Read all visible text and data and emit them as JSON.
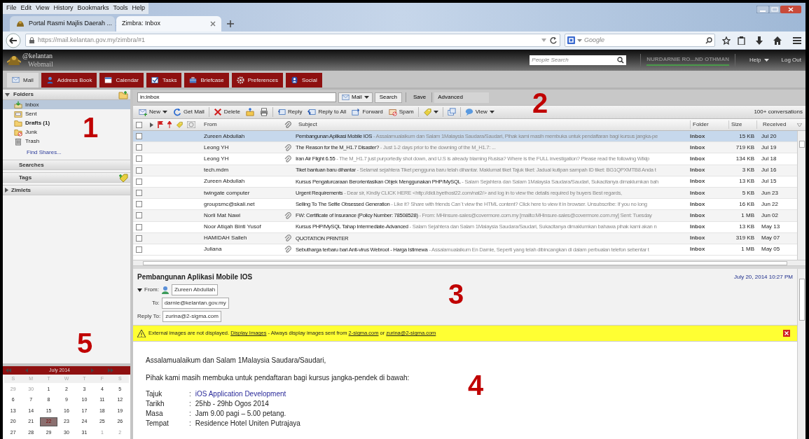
{
  "browser": {
    "menu": [
      "File",
      "Edit",
      "View",
      "History",
      "Bookmarks",
      "Tools",
      "Help"
    ],
    "tabs": [
      {
        "label": "Portal Rasmi Majlis Daerah ...",
        "selected": false
      },
      {
        "label": "Zimbra: Inbox",
        "selected": true
      }
    ],
    "url": "https://mail.kelantan.gov.my/zimbra/#1",
    "search_placeholder": "Google"
  },
  "header": {
    "logo_line1": "@kelantan",
    "logo_line2": "Webmail",
    "people_search_placeholder": "People Search",
    "user": "NURDARNIE RO...ND OTHMAN",
    "help": "Help",
    "logout": "Log Out"
  },
  "app_tabs": [
    {
      "label": "Mail",
      "kind": "mail",
      "selected": true
    },
    {
      "label": "Address Book",
      "kind": "contacts",
      "selected": false
    },
    {
      "label": "Calendar",
      "kind": "calendar",
      "selected": false
    },
    {
      "label": "Tasks",
      "kind": "tasks",
      "selected": false
    },
    {
      "label": "Briefcase",
      "kind": "briefcase",
      "selected": false
    },
    {
      "label": "Preferences",
      "kind": "preferences",
      "selected": false
    },
    {
      "label": "Social",
      "kind": "social",
      "selected": false
    }
  ],
  "sidebar": {
    "folders_title": "Folders",
    "folders": [
      {
        "label": "Inbox",
        "kind": "inbox",
        "selected": true,
        "unread": false
      },
      {
        "label": "Sent",
        "kind": "sent",
        "selected": false,
        "unread": false
      },
      {
        "label": "Drafts (1)",
        "kind": "drafts",
        "selected": false,
        "unread": true
      },
      {
        "label": "Junk",
        "kind": "junk",
        "selected": false,
        "unread": false
      },
      {
        "label": "Trash",
        "kind": "trash",
        "selected": false,
        "unread": false
      }
    ],
    "find_shares": "Find Shares...",
    "sections": [
      {
        "label": "Searches",
        "kind": "plain"
      },
      {
        "label": "Tags",
        "kind": "tags"
      },
      {
        "label": "Zimlets",
        "kind": "collapsed"
      }
    ]
  },
  "calendar": {
    "month": "July 2014",
    "weekdays": [
      "S",
      "M",
      "T",
      "W",
      "T",
      "F",
      "S"
    ],
    "days": [
      {
        "day": "29",
        "other_month": true,
        "selected": false
      },
      {
        "day": "30",
        "other_month": true,
        "selected": false
      },
      {
        "day": "1",
        "other_month": false,
        "selected": false
      },
      {
        "day": "2",
        "other_month": false,
        "selected": false
      },
      {
        "day": "3",
        "other_month": false,
        "selected": false
      },
      {
        "day": "4",
        "other_month": false,
        "selected": false
      },
      {
        "day": "5",
        "other_month": false,
        "selected": false
      },
      {
        "day": "6",
        "other_month": false,
        "selected": false
      },
      {
        "day": "7",
        "other_month": false,
        "selected": false
      },
      {
        "day": "8",
        "other_month": false,
        "selected": false
      },
      {
        "day": "9",
        "other_month": false,
        "selected": false
      },
      {
        "day": "10",
        "other_month": false,
        "selected": false
      },
      {
        "day": "11",
        "other_month": false,
        "selected": false
      },
      {
        "day": "12",
        "other_month": false,
        "selected": false
      },
      {
        "day": "13",
        "other_month": false,
        "selected": false
      },
      {
        "day": "14",
        "other_month": false,
        "selected": false
      },
      {
        "day": "15",
        "other_month": false,
        "selected": false
      },
      {
        "day": "16",
        "other_month": false,
        "selected": false
      },
      {
        "day": "17",
        "other_month": false,
        "selected": false
      },
      {
        "day": "18",
        "other_month": false,
        "selected": false
      },
      {
        "day": "19",
        "other_month": false,
        "selected": false
      },
      {
        "day": "20",
        "other_month": false,
        "selected": false
      },
      {
        "day": "21",
        "other_month": false,
        "selected": false
      },
      {
        "day": "22",
        "other_month": false,
        "selected": true
      },
      {
        "day": "23",
        "other_month": false,
        "selected": false
      },
      {
        "day": "24",
        "other_month": false,
        "selected": false
      },
      {
        "day": "25",
        "other_month": false,
        "selected": false
      },
      {
        "day": "26",
        "other_month": false,
        "selected": false
      },
      {
        "day": "27",
        "other_month": false,
        "selected": false
      },
      {
        "day": "28",
        "other_month": false,
        "selected": false
      },
      {
        "day": "29",
        "other_month": false,
        "selected": false
      },
      {
        "day": "30",
        "other_month": false,
        "selected": false
      },
      {
        "day": "31",
        "other_month": false,
        "selected": false
      },
      {
        "day": "1",
        "other_month": true,
        "selected": false
      },
      {
        "day": "2",
        "other_month": true,
        "selected": false
      }
    ]
  },
  "search": {
    "query": "in:inbox",
    "type": "Mail",
    "search": "Search",
    "save": "Save",
    "advanced": "Advanced"
  },
  "toolbar": [
    {
      "label": "New",
      "kind": "new",
      "menu": true
    },
    {
      "label": "Get Mail",
      "kind": "refresh",
      "menu": false
    },
    {
      "label": "Delete",
      "kind": "delete",
      "menu": false
    },
    {
      "kind": "move",
      "menu": false
    },
    {
      "kind": "print",
      "menu": false
    },
    {
      "label": "Reply",
      "kind": "reply",
      "menu": false
    },
    {
      "label": "Reply to All",
      "kind": "replyall",
      "menu": false
    },
    {
      "label": "Forward",
      "kind": "forward",
      "menu": false
    },
    {
      "label": "Spam",
      "kind": "spam",
      "menu": false
    },
    {
      "kind": "tag",
      "menu": true
    },
    {
      "kind": "window",
      "menu": false
    },
    {
      "label": "View",
      "kind": "view",
      "menu": true
    }
  ],
  "select_all_checked": false,
  "conversation_count": "100+ conversations",
  "columns": {
    "from": "From",
    "subject": "Subject",
    "folder": "Folder",
    "size": "Size",
    "received": "Received"
  },
  "messages": [
    {
      "from": "Zureen Abdullah",
      "attachment": false,
      "subject": "Pembangunan Aplikasi Mobile IOS",
      "preview": " - Assalamualaikum dan Salam 1Malaysia Saudara/Saudari, Pihak kami masih membuka untuk pendaftaran bagi kursus jangka-pe",
      "folder": "Inbox",
      "size": "15 KB",
      "received": "Jul 20",
      "selected": true
    },
    {
      "from": "Leong YH",
      "attachment": true,
      "subject": "The Reason for the M_H1.7 Disaster?",
      "preview": " - Just 1-2 days prior to the downing of the M_H1.7: ...",
      "folder": "Inbox",
      "size": "719 KB",
      "received": "Jul 19",
      "selected": false
    },
    {
      "from": "Leong YH",
      "attachment": true,
      "subject": "Iran Air Flight 6.55",
      "preview": " - The M_H1.7 just purportedly shot down, and U.S is already blaming Rusisa? Where is the FULL investigation? Please read the following Wikip",
      "folder": "Inbox",
      "size": "134 KB",
      "received": "Jul 18",
      "selected": false
    },
    {
      "from": "tech.mdm",
      "attachment": false,
      "subject": "Tiket bantuan baru dihantar",
      "preview": " - Selamat sejahtera Tiket pengguna baru telah dihantar. Maklumat tiket Tajuk tiket: Jadual kutipan sampah ID tiket: BG1QPXMTB8 Anda t",
      "folder": "Inbox",
      "size": "3 KB",
      "received": "Jul 16",
      "selected": false
    },
    {
      "from": "Zureen Abdullah",
      "attachment": false,
      "subject": "Kursus Pengaturcaraan Berorientasikan Objek Menggunakan PHP/MySQL",
      "preview": " - Salam Sejahtera dan Salam 1Malaysia Saudara/Saudari, Sukacitanya dimaklumkan bah",
      "folder": "Inbox",
      "size": "13 KB",
      "received": "Jul 15",
      "selected": false
    },
    {
      "from": "twingate computer",
      "attachment": false,
      "subject": "Urgent Requirements",
      "preview": " - Dear sir, Kindly CLICK HERE <http://didi.byethost22.com/nat2/> and log in to view the details required by buyers Best regards,",
      "folder": "Inbox",
      "size": "5 KB",
      "received": "Jun 23",
      "selected": false
    },
    {
      "from": "groupsmc@skali.net",
      "attachment": false,
      "subject": "Selling To The Selfie Obsessed Generation",
      "preview": " - Like it? Share with friends Can`t view the HTML content? Click here to view it in browser. Unsubscribe: If you no long",
      "folder": "Inbox",
      "size": "16 KB",
      "received": "Jun 22",
      "selected": false
    },
    {
      "from": "Norli Mat Nawi",
      "attachment": true,
      "subject": "FW: Certificate of Insurance (Policy Number: 78508528)",
      "preview": " - From: MHinsure-sales@covermore.com.my [mailto:MHinsure-sales@covermore.com.my] Sent: Tuesday",
      "folder": "Inbox",
      "size": "1 MB",
      "received": "Jun 02",
      "selected": false
    },
    {
      "from": "Noor Atiqah Binti Yusof",
      "attachment": false,
      "subject": "Kursus PHP/MySQL Tahap Intermediate-Advanced",
      "preview": " - Salam Sejahtera dan Salam 1Malaysia Saudara/Saudari, Sukacitanya dimaklumkan bahawa pihak kami akan n",
      "folder": "Inbox",
      "size": "13 KB",
      "received": "May 13",
      "selected": false
    },
    {
      "from": "HAMIDAH Salleh",
      "attachment": true,
      "subject": "QUOTATION PRINTER",
      "folder": "Inbox",
      "size": "319 KB",
      "received": "May 07",
      "selected": false
    },
    {
      "from": "Juliana",
      "attachment": true,
      "subject": "Sebutharga terbaru bari Anti-virus Webroot - Harga Istimewa",
      "preview": " - Assalamualaikum En Darnie, Seperti yang telah dibincangkan di dalam perbualan telefon sebentar t",
      "folder": "Inbox",
      "size": "1 MB",
      "received": "May 05",
      "selected": false
    }
  ],
  "reading": {
    "subject": "Pembangunan Aplikasi Mobile IOS",
    "date": "July 20, 2014 10:27 PM",
    "from_label": "From:",
    "from": "Zureen Abdullah",
    "to_label": "To:",
    "to": "darnie@kelantan.gov.my",
    "reply_to_label": "Reply To:",
    "reply_to": "zurina@2-sigma.com",
    "warning": [
      "External images are not displayed. ",
      "Display Images",
      " - Always display images sent from ",
      "2-sigma.com",
      " or ",
      "zurina@2-sigma.com"
    ],
    "paragraphs": [
      "Assalamualaikum dan Salam 1Malaysia Saudara/Saudari,",
      "Pihak kami masih membuka untuk pendaftaran bagi kursus jangka-pendek di bawah:"
    ],
    "details": [
      {
        "label": "Tajuk",
        "sep": ":",
        "value": "iOS Application Development",
        "link": true
      },
      {
        "label": "Tarikh",
        "sep": ":",
        "value": "25hb - 29hb Ogos 2014",
        "link": false
      },
      {
        "label": "Masa",
        "sep": ":",
        "value": "Jam 9.00 pagi – 5.00 petang.",
        "link": false
      },
      {
        "label": "Tempat",
        "sep": ":",
        "value": "Residence Hotel Uniten Putrajaya",
        "link": false
      }
    ]
  },
  "callouts": [
    "1",
    "2",
    "3",
    "4",
    "5"
  ]
}
